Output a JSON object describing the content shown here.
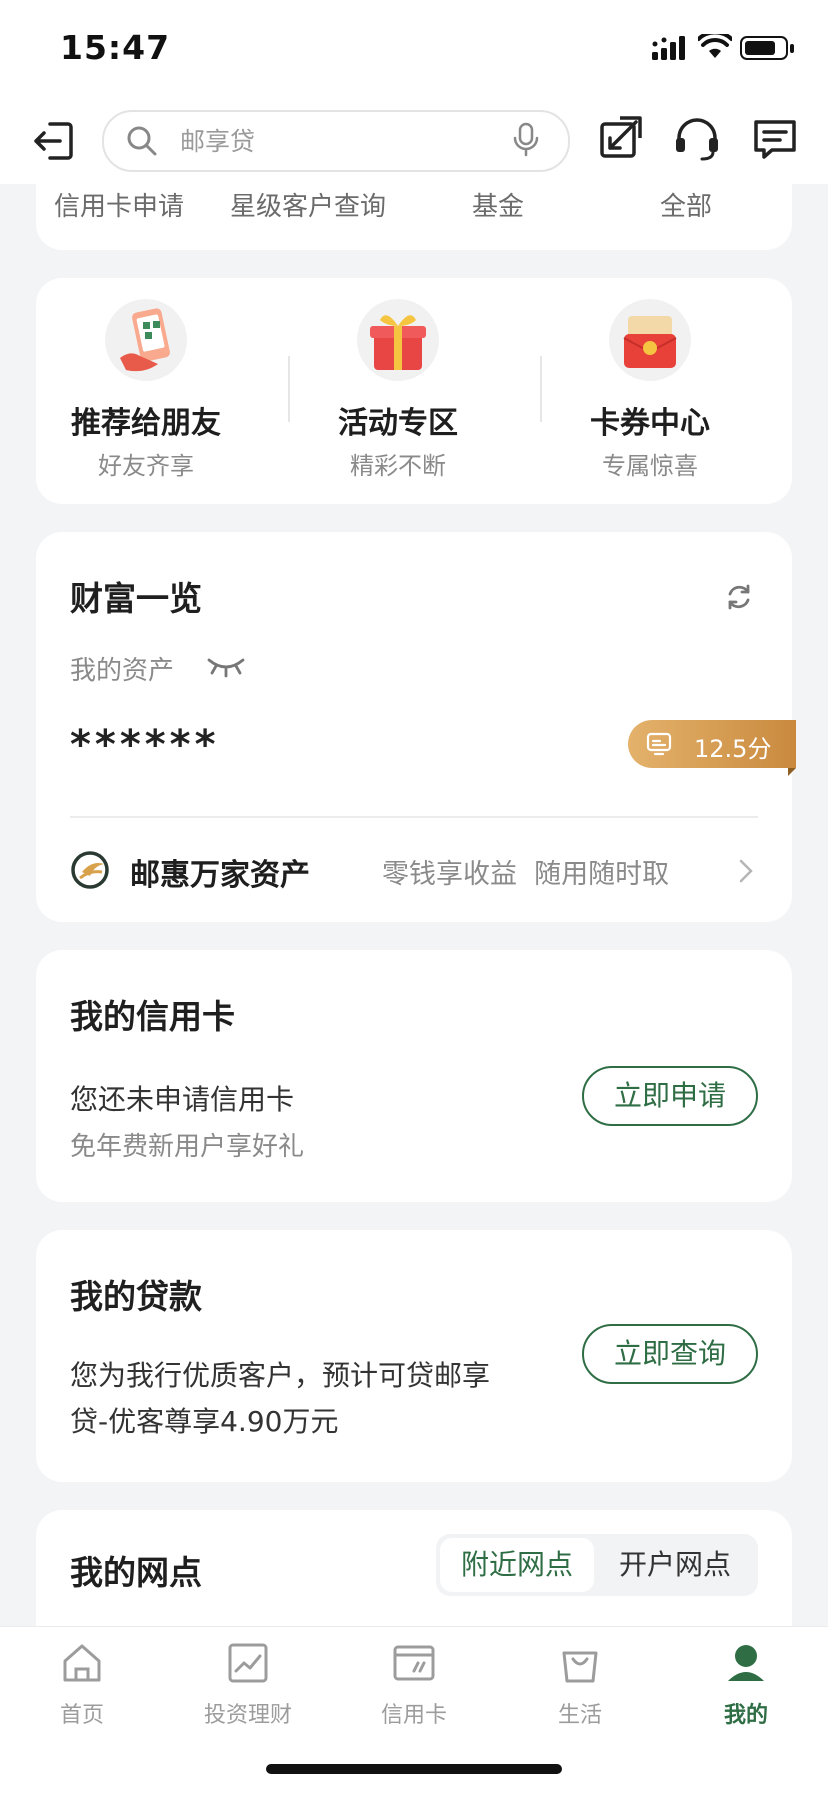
{
  "status_bar": {
    "time": "15:47"
  },
  "header": {
    "search_placeholder": "邮享贷"
  },
  "quick_menu": {
    "items": [
      "信用卡申请",
      "星级客户查询",
      "基金",
      "全部"
    ]
  },
  "promo_tiles": [
    {
      "title": "推荐给朋友",
      "subtitle": "好友齐享"
    },
    {
      "title": "活动专区",
      "subtitle": "精彩不断"
    },
    {
      "title": "卡券中心",
      "subtitle": "专属惊喜"
    }
  ],
  "wealth": {
    "title": "财富一览",
    "assets_label": "我的资产",
    "masked_value": "******",
    "score_badge": "12.5分",
    "product_name": "邮惠万家资产",
    "product_desc": "零钱享收益  随用随时取"
  },
  "credit_card": {
    "title": "我的信用卡",
    "line1": "您还未申请信用卡",
    "line2": "免年费新用户享好礼",
    "button": "立即申请"
  },
  "loan": {
    "title": "我的贷款",
    "line1": "您为我行优质客户，预计可贷邮享",
    "line2": "贷-优客尊享4.90万元",
    "button": "立即查询"
  },
  "branches": {
    "title": "我的网点",
    "tabs": [
      "附近网点",
      "开户网点"
    ]
  },
  "tabbar": {
    "items": [
      "首页",
      "投资理财",
      "信用卡",
      "生活",
      "我的"
    ],
    "active": "我的"
  },
  "colors": {
    "accent": "#2f6e45",
    "badge": "#d29a4f"
  }
}
